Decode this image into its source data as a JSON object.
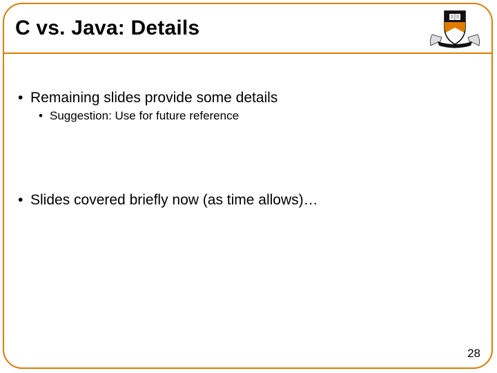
{
  "title": "C vs. Java: Details",
  "bullets": {
    "b0": "Remaining slides provide some details",
    "b0_sub0": "Suggestion:  Use for future reference",
    "b1": "Slides covered briefly now (as time allows)…"
  },
  "page_number": "28"
}
